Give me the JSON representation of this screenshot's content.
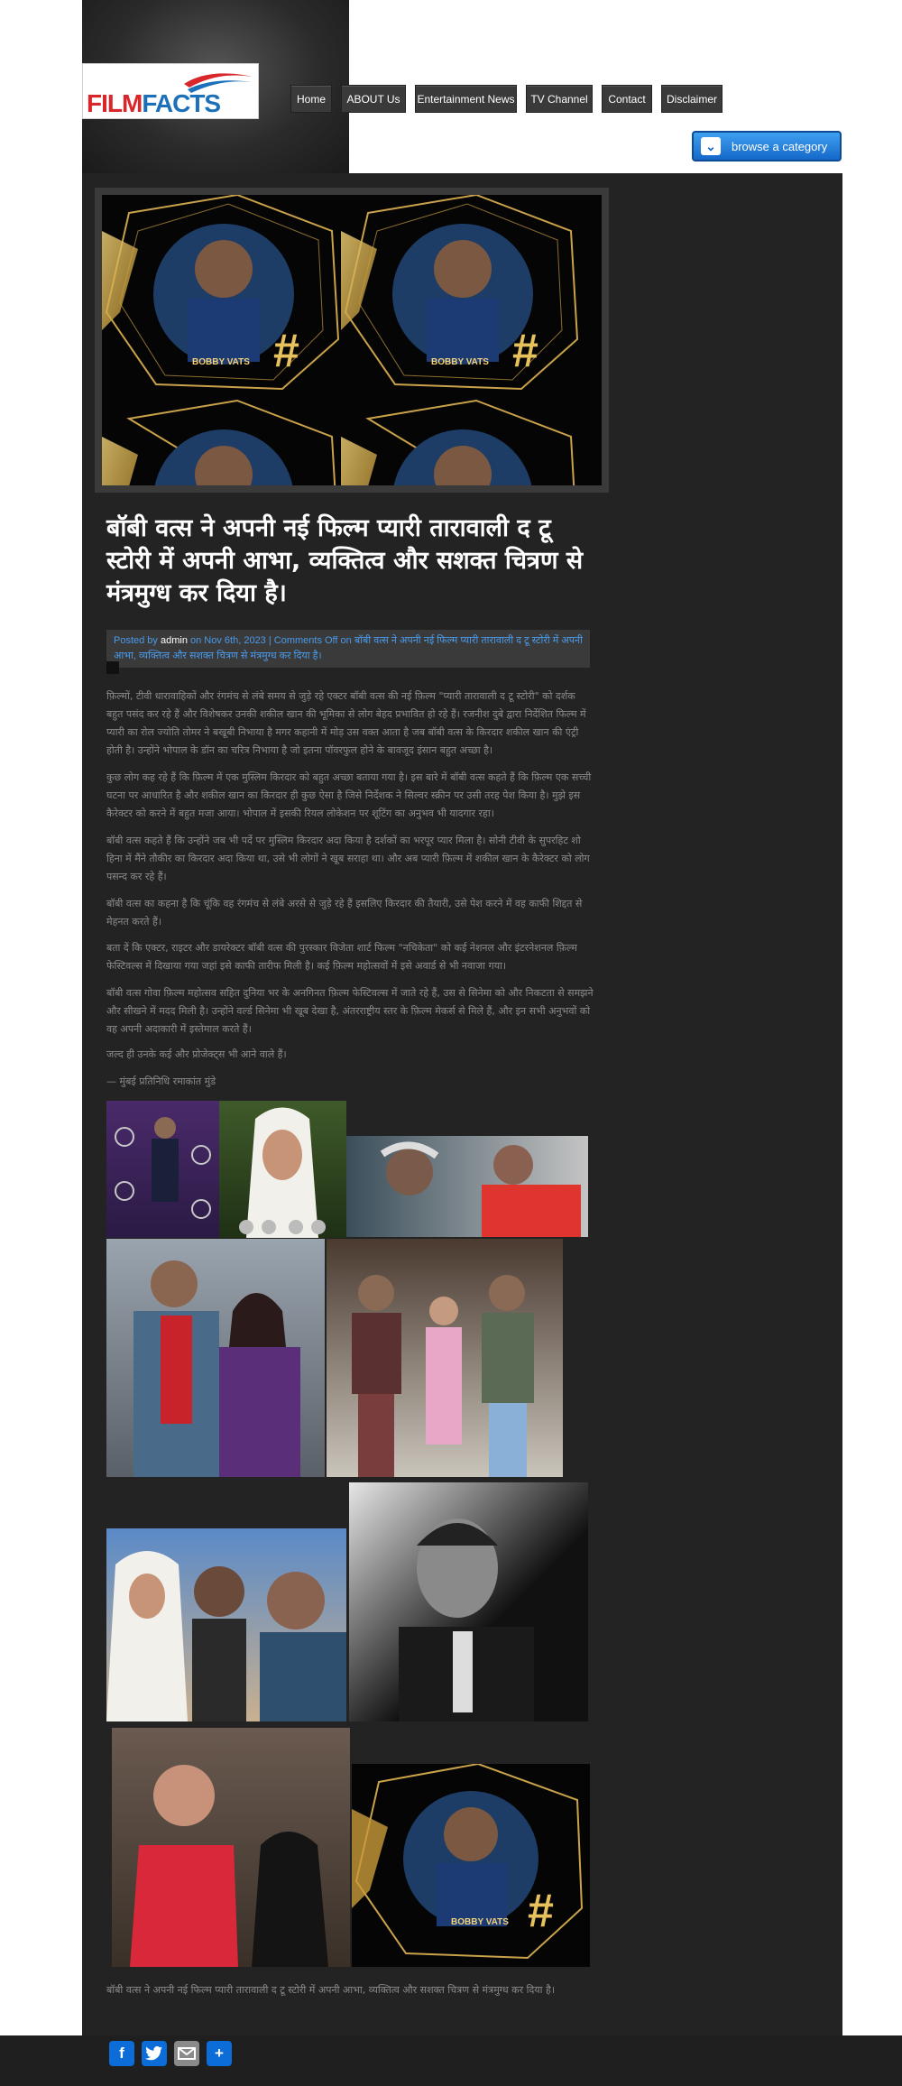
{
  "site": {
    "logo_part1": "FILM",
    "logo_part2": "FACTS"
  },
  "nav": {
    "items": [
      "Home",
      "ABOUT Us",
      "Entertainment News",
      "TV Channel",
      "Contact",
      "Disclaimer"
    ]
  },
  "browse": {
    "label": "browse a category"
  },
  "hero": {
    "caption_left": "BOBBY VATS",
    "caption_right": "BOBBY VATS"
  },
  "post": {
    "title": "बॉबी वत्स ने अपनी नई फिल्म प्यारी तारावाली द टू स्टोरी में अपनी आभा, व्यक्तित्व और सशक्त चित्रण से मंत्रमुग्ध कर दिया है।",
    "meta_posted": "Posted by",
    "meta_author": "admin",
    "meta_rest": "on Nov 6th, 2023 | Comments Off on बॉबी वत्स ने अपनी नई फिल्म प्यारी तारावाली द टू स्टोरी में अपनी आभा, व्यक्तित्व और सशक्त चित्रण से मंत्रमुग्ध कर दिया है।",
    "paragraphs": [
      "फ़िल्मों, टीवी धारावाहिकों और रंगमंच से लंबे समय से जुड़े रहे एक्टर बॉबी वत्स की नई फ़िल्म \"प्यारी तारावाली द टू स्टोरी\" को दर्शक बहुत पसंद कर रहे हैं और विशेषकर उनकी शकील खान की भूमिका से लोग बेहद प्रभावित हो रहे हैं। रजनीश दुबे द्वारा निर्देशित फिल्म में प्यारी का रोल ज्योति तोमर ने बखूबी निभाया है मगर कहानी में मोड़ उस वक्त आता है जब बॉबी वत्स के किरदार शकील खान की एंट्री होती है। उन्होंने भोपाल के डॉन का चरित्र निभाया है जो इतना पॉवरफुल होने के बावजूद इंसान बहुत अच्छा है।",
      "कुछ लोग कह रहे हैं कि फ़िल्म में एक मुस्लिम किरदार को बहुत अच्छा बताया गया है। इस बारे में बॉबी वत्स कहते हैं कि फ़िल्म एक सच्ची घटना पर आधारित है और शकील खान का किरदार ही कुछ ऐसा है जिसे निर्देशक ने सिल्वर स्क्रीन पर उसी तरह पेश किया है। मुझे इस कैरेक्टर को करने में बहुत मजा आया। भोपाल में इसकी रियल लोकेशन पर शूटिंग का अनुभव भी यादगार रहा।",
      "बॉबी वत्स कहते हैं कि उन्होंने जब भी पर्दे पर मुस्लिम किरदार अदा किया है दर्शकों का भरपूर प्यार मिला है। सोनी टीवी के सुपरहिट शो हिना में मैंने तौकीर का किरदार अदा किया था, उसे भी लोगों ने खूब सराहा था। और अब प्यारी फ़िल्म में शकील खान के कैरेक्टर को लोग पसन्द कर रहे हैं।",
      "बॉबी वत्स का कहना है कि चूंकि वह रंगमंच से लंबे अरसे से जुड़े रहे हैं इसलिए किरदार की तैयारी, उसे पेश करने में वह काफी शिद्दत से मेहनत करते हैं।",
      "बता दें कि एक्टर, राइटर और डायरेक्टर बॉबी वत्स की पुरस्कार विजेता शार्ट फिल्म \"नचिकेता\" को कई नेशनल और इंटरनेशनल फ़िल्म फेस्टिवल्स में दिखाया गया जहां इसे काफी तारीफ मिली है। कई फ़िल्म महोत्सवों में इसे अवार्ड से भी नवाजा गया।",
      "बॉबी वत्स गोवा फ़िल्म महोत्सव सहित दुनिया भर के अनगिनत फ़िल्म फेस्टिवल्स में जाते रहे हैं, उस से सिनेमा को और निकटता से समझने और सीखने में मदद मिली है। उन्होंने वर्ल्ड सिनेमा भी खूब देखा है, अंतरराष्ट्रीय स्तर के फ़िल्म मेकर्स से मिले हैं, और इन सभी अनुभवों को वह अपनी अदाकारी में इस्तेमाल करते हैं।",
      "जल्द ही उनके कई और प्रोजेक्ट्स भी आने वाले हैं।",
      "— मुंबई प्रतिनिधि रमाकांत मुंडे"
    ],
    "closing": "बॉबी वत्स ने अपनी नई फिल्म प्यारी तारावाली द टू स्टोरी में अपनी आभा, व्यक्तित्व और सशक्त चित्रण से मंत्रमुग्ध कर दिया है।"
  },
  "share": {
    "icons": [
      "facebook-icon",
      "twitter-icon",
      "email-icon",
      "share-plus-icon"
    ],
    "brand_color": "#0d6dd8"
  }
}
